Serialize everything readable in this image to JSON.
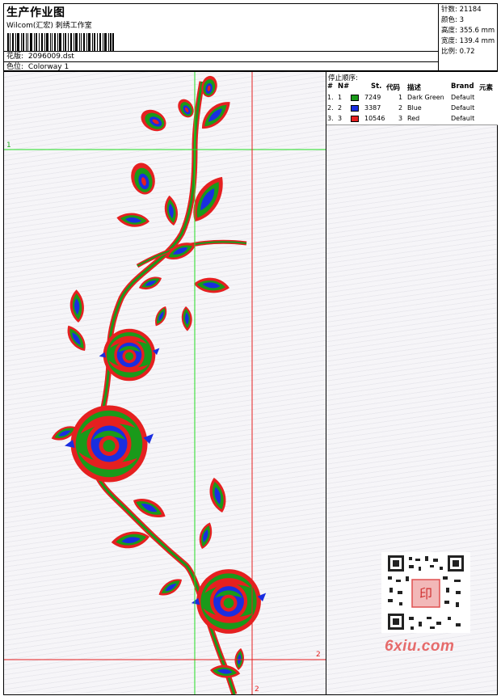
{
  "header": {
    "title": "生产作业图",
    "subtitle": "Wilcom(汇宏) 刺绣工作室",
    "design_label": "花版:",
    "design_value": "2096009.dst",
    "colorway_label": "色位:",
    "colorway_value": "Colorway 1"
  },
  "stats": {
    "stitches_label": "针数:",
    "stitches_value": "21184",
    "colors_label": "颜色:",
    "colors_value": "3",
    "height_label": "高度:",
    "height_value": "355.6 mm",
    "width_label": "宽度:",
    "width_value": "139.4 mm",
    "scale_label": "比例:",
    "scale_value": "0.72"
  },
  "stop_sequence": {
    "heading": "停止顺序:",
    "columns": [
      "#",
      "N#",
      "St.",
      "代码",
      "描述",
      "Brand",
      "元素"
    ],
    "rows": [
      {
        "index": "1.",
        "n": "1",
        "color": "#1a9a1a",
        "stitches": "7249",
        "code": "1",
        "description": "Dark Green",
        "brand": "Default"
      },
      {
        "index": "2.",
        "n": "2",
        "color": "#1a2ee0",
        "stitches": "3387",
        "code": "2",
        "description": "Blue",
        "brand": "Default"
      },
      {
        "index": "3.",
        "n": "3",
        "color": "#e52020",
        "stitches": "10546",
        "code": "3",
        "description": "Red",
        "brand": "Default"
      }
    ]
  },
  "guides": {
    "green_label": "1",
    "red_label_right": "2",
    "red_label_bottom": "2"
  },
  "watermark": "6xiu.com",
  "qr_stamp": "印"
}
